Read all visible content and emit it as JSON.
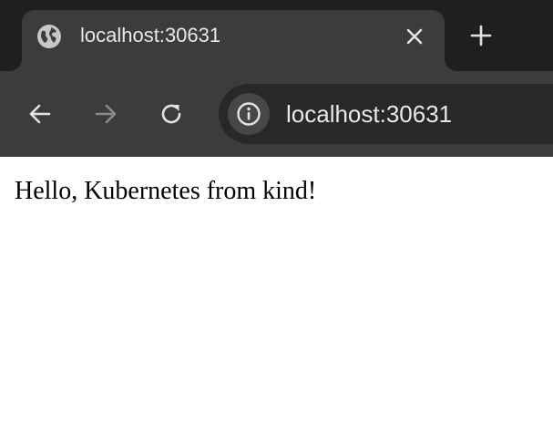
{
  "tab": {
    "title": "localhost:30631",
    "favicon": "globe-icon",
    "close_icon": "close-icon"
  },
  "tab_strip": {
    "new_tab_icon": "plus-icon"
  },
  "toolbar": {
    "back_icon": "arrow-left-icon",
    "forward_icon": "arrow-right-icon",
    "reload_icon": "reload-icon",
    "forward_enabled": false
  },
  "omnibox": {
    "site_info_icon": "info-icon",
    "url": "localhost:30631"
  },
  "page": {
    "body_text": "Hello, Kubernetes from kind!"
  },
  "colors": {
    "tab_strip_bg": "#1f1f1f",
    "toolbar_bg": "#3c3c3c",
    "omnibox_bg": "#282828",
    "text_light": "#e8e8e8",
    "page_bg": "#ffffff"
  }
}
